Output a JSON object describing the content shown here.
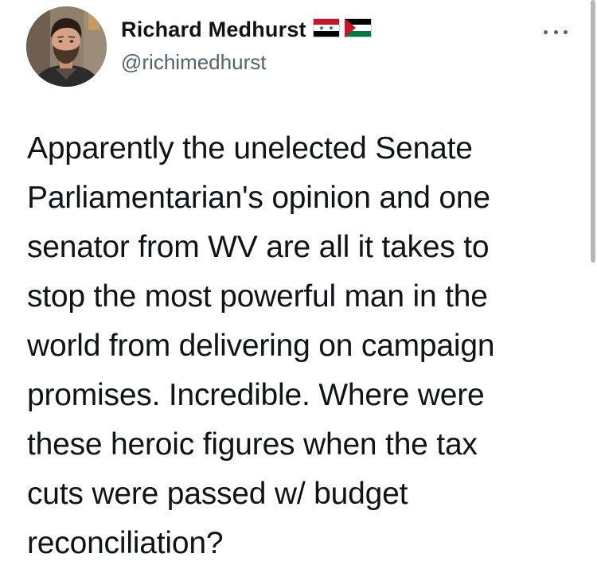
{
  "profile": {
    "display_name": "Richard Medhurst",
    "handle": "@richimedhurst",
    "flags": [
      "syria-flag-icon",
      "palestine-flag-icon"
    ]
  },
  "menu": {
    "more_icon": "more-options-icon"
  },
  "tweet": {
    "lines": [
      "Apparently the unelected Senate",
      "Parliamentarian's opinion and one",
      "senator from WV are all it takes to",
      "stop the most powerful man in the",
      "world from delivering on campaign",
      "promises. Incredible. Where were",
      "these heroic figures when the tax",
      "cuts were passed w/ budget",
      "reconciliation?"
    ]
  },
  "colors": {
    "text": "#0f1419",
    "secondary": "#536471",
    "background": "#ffffff"
  }
}
